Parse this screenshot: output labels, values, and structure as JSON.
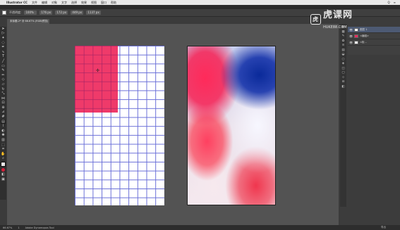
{
  "menubar": {
    "app_name": "Illustrator CC",
    "items": [
      "文件",
      "编辑",
      "对象",
      "文字",
      "选择",
      "效果",
      "视图",
      "窗口",
      "帮助"
    ],
    "right_items": [
      "Q",
      "≡"
    ]
  },
  "options_bar": {
    "label": "不透明度:",
    "opacity": "100%",
    "x": "176 px",
    "y": "172 px",
    "w": "449 px",
    "h": "1137 px"
  },
  "document_tab": {
    "title": "未标题-2* @ 66.67% (RGB/预览)"
  },
  "watermark": {
    "logo": "虎",
    "text": "虎课网",
    "sub": "HUKE88.COM"
  },
  "layers": [
    {
      "name": "图层 1",
      "selected": true
    },
    {
      "name": "<编组>",
      "selected": false
    },
    {
      "name": "<矩...",
      "selected": false
    }
  ],
  "status": {
    "zoom": "66.67%",
    "page": "1",
    "tool": "Adobe Dynamopos Tool",
    "right": "导出"
  },
  "colors": {
    "pink": "#ee2a5e",
    "grid": "#6a6fd8",
    "gradient_blue": "#0a2a9a"
  },
  "tools": [
    "selection-icon",
    "direct-selection-icon",
    "magic-wand-icon",
    "lasso-icon",
    "pen-icon",
    "curvature-icon",
    "type-icon",
    "line-icon",
    "rectangle-icon",
    "paintbrush-icon",
    "pencil-icon",
    "shaper-icon",
    "eraser-icon",
    "rotate-icon",
    "scale-icon",
    "width-icon",
    "free-transform-icon",
    "shape-builder-icon",
    "perspective-icon",
    "mesh-icon",
    "gradient-icon",
    "eyedropper-icon",
    "blend-icon",
    "symbol-sprayer-icon",
    "graph-icon",
    "artboard-icon",
    "slice-icon",
    "hand-icon",
    "zoom-icon"
  ]
}
